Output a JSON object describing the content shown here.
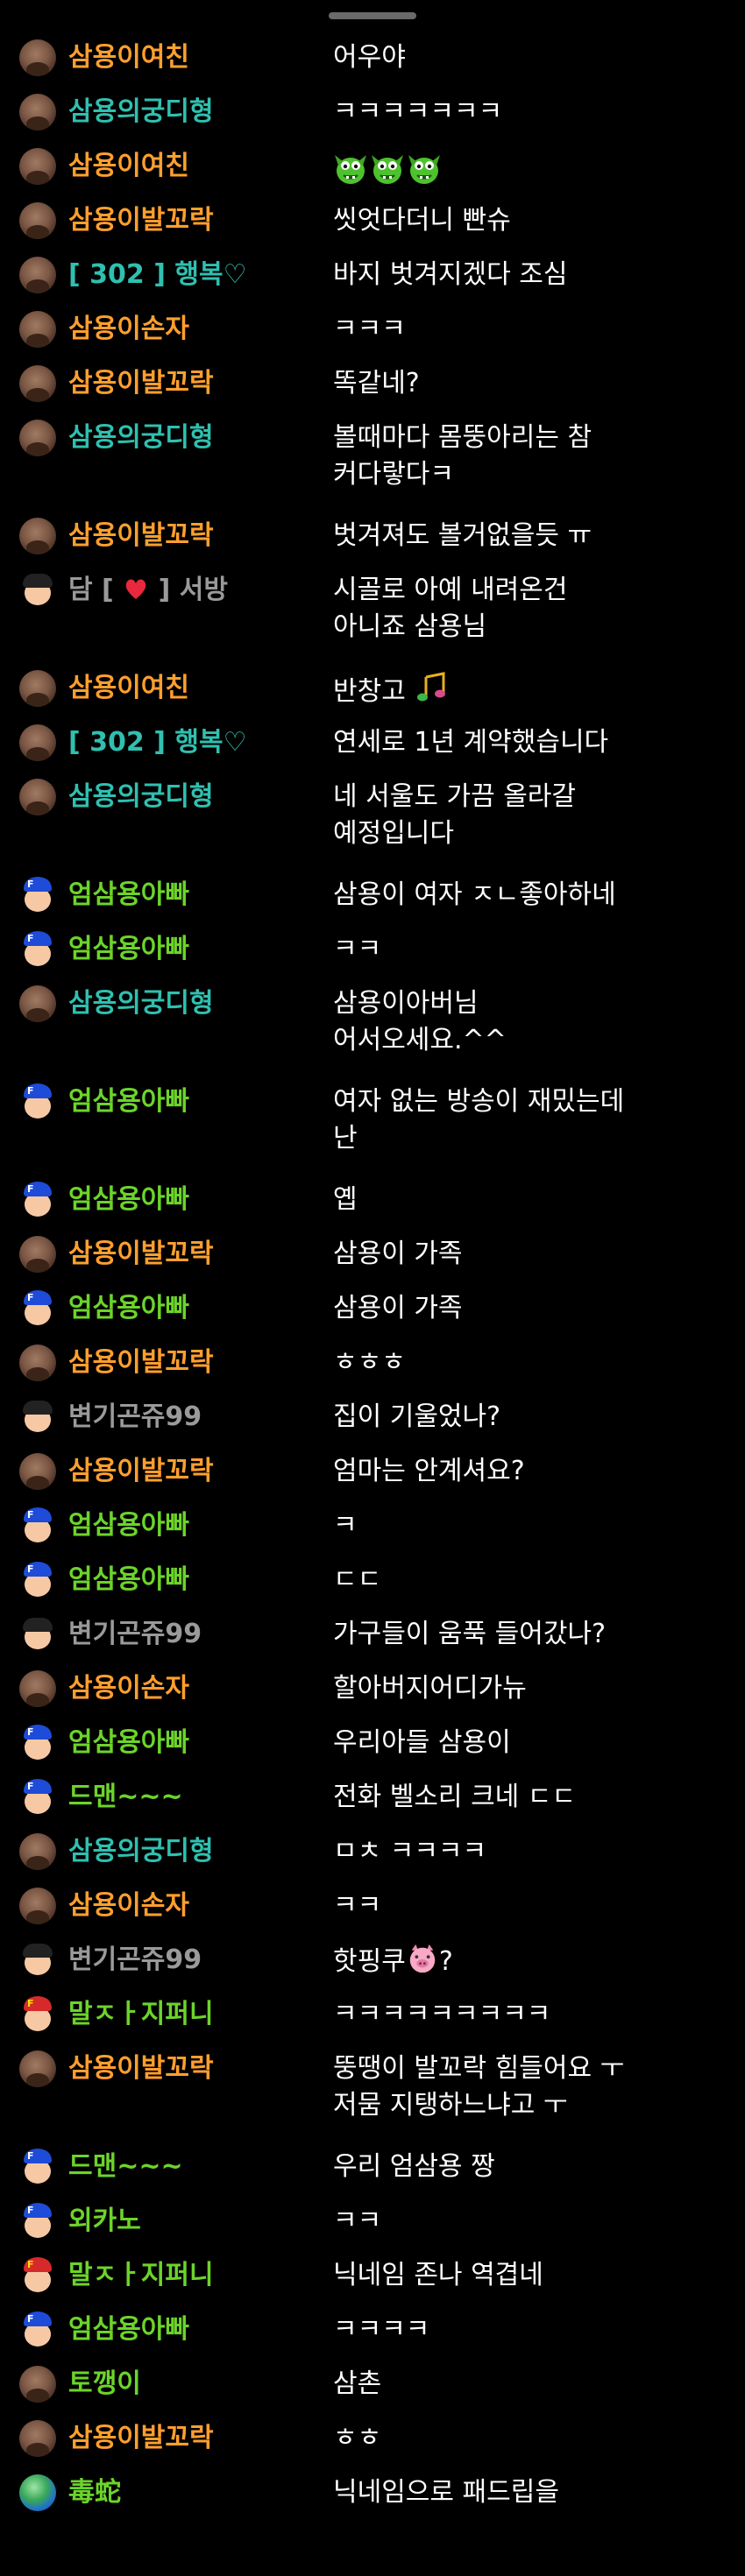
{
  "colors": {
    "background": "#000000",
    "message": "#ffffff",
    "orange": "#ff9f2e",
    "teal": "#2fc0b0",
    "green": "#6cd42a",
    "gray": "#9a9a9a",
    "purple_red": "#cc3d5a"
  },
  "chat": [
    {
      "user": "삼용이여친",
      "color": "#ff9f2e",
      "avatar": "round-brown",
      "text": "어우야"
    },
    {
      "user": "삼용의궁디형",
      "color": "#2fc0b0",
      "avatar": "round-brown",
      "text": "ㅋㅋㅋㅋㅋㅋㅋ"
    },
    {
      "user": "삼용이여친",
      "color": "#ff9f2e",
      "avatar": "round-brown",
      "text": "",
      "emote": "green-monster-emote",
      "emote_count": 3
    },
    {
      "user": "삼용이발꼬락",
      "color": "#ff9f2e",
      "avatar": "round-brown",
      "text": "씻엇다더니 빤슈"
    },
    {
      "user": "[ 302 ] 행복♡",
      "color": "#2fc0b0",
      "avatar": "round-brown",
      "text": "바지 벗겨지겠다 조심"
    },
    {
      "user": "삼용이손자",
      "color": "#ff9f2e",
      "avatar": "round-brown",
      "text": "ㅋㅋㅋ"
    },
    {
      "user": "삼용이발꼬락",
      "color": "#ff9f2e",
      "avatar": "round-brown",
      "text": "똑같네?"
    },
    {
      "user": "삼용의궁디형",
      "color": "#2fc0b0",
      "avatar": "round-brown",
      "text": "볼때마다 몸뚱아리는 참\n커다랗다ㅋ"
    },
    {
      "user": "삼용이발꼬락",
      "color": "#ff9f2e",
      "avatar": "round-brown",
      "text": "벗겨져도 볼거없을듯 ㅠ"
    },
    {
      "user_prefix": "담 [",
      "user_suffix": "] 서방",
      "heart": true,
      "color": "#9a9a9a",
      "avatar": "face-kid",
      "text": "시골로 아예 내려온건\n아니죠 삼용님"
    },
    {
      "user": "삼용이여친",
      "color": "#ff9f2e",
      "avatar": "round-brown",
      "text": "반창고",
      "icon": "music-note-icon"
    },
    {
      "user": "[ 302 ] 행복♡",
      "color": "#2fc0b0",
      "avatar": "round-brown",
      "text": "연세로 1년 계약했습니다"
    },
    {
      "user": "삼용의궁디형",
      "color": "#2fc0b0",
      "avatar": "round-brown",
      "text": "네 서울도 가끔 올라갈\n예정입니다"
    },
    {
      "user": "엄삼용아빠",
      "color": "#6cd42a",
      "avatar": "face-cap-blue",
      "text": "삼용이 여자 ㅈㄴ좋아하네"
    },
    {
      "user": "엄삼용아빠",
      "color": "#6cd42a",
      "avatar": "face-cap-blue",
      "text": "ㅋㅋ"
    },
    {
      "user": "삼용의궁디형",
      "color": "#2fc0b0",
      "avatar": "round-brown",
      "text": "삼용이아버님\n어서오세요.^^"
    },
    {
      "user": "엄삼용아빠",
      "color": "#6cd42a",
      "avatar": "face-cap-blue",
      "text": "여자 없는 방송이 재밌는데\n난"
    },
    {
      "user": "엄삼용아빠",
      "color": "#6cd42a",
      "avatar": "face-cap-blue",
      "text": "옙"
    },
    {
      "user": "삼용이발꼬락",
      "color": "#ff9f2e",
      "avatar": "round-brown",
      "text": "삼용이 가족"
    },
    {
      "user": "엄삼용아빠",
      "color": "#6cd42a",
      "avatar": "face-cap-blue",
      "text": "삼용이 가족"
    },
    {
      "user": "삼용이발꼬락",
      "color": "#ff9f2e",
      "avatar": "round-brown",
      "text": "ㅎㅎㅎ"
    },
    {
      "user": "변기곤쥬99",
      "color": "#9a9a9a",
      "avatar": "face-kid",
      "text": "집이 기울었나?"
    },
    {
      "user": "삼용이발꼬락",
      "color": "#ff9f2e",
      "avatar": "round-brown",
      "text": "엄마는 안계셔요?"
    },
    {
      "user": "엄삼용아빠",
      "color": "#6cd42a",
      "avatar": "face-cap-blue",
      "text": "ㅋ"
    },
    {
      "user": "엄삼용아빠",
      "color": "#6cd42a",
      "avatar": "face-cap-blue",
      "text": "ㄷㄷ"
    },
    {
      "user": "변기곤쥬99",
      "color": "#9a9a9a",
      "avatar": "face-kid",
      "text": "가구들이 움푹 들어갔나?"
    },
    {
      "user": "삼용이손자",
      "color": "#ff9f2e",
      "avatar": "round-brown",
      "text": "할아버지어디가뉴"
    },
    {
      "user": "엄삼용아빠",
      "color": "#6cd42a",
      "avatar": "face-cap-blue",
      "text": "우리아들 삼용이"
    },
    {
      "user": "드맨~~~",
      "color": "#6cd42a",
      "avatar": "face-cap-blue",
      "text": "전화 벨소리 크네 ㄷㄷ"
    },
    {
      "user": "삼용의궁디형",
      "color": "#2fc0b0",
      "avatar": "round-brown",
      "text": "ㅁㅊ ㅋㅋㅋㅋ"
    },
    {
      "user": "삼용이손자",
      "color": "#ff9f2e",
      "avatar": "round-brown",
      "text": "ㅋㅋ"
    },
    {
      "user": "변기곤쥬99",
      "color": "#9a9a9a",
      "avatar": "face-kid",
      "text": "핫핑쿠",
      "text_after": "?",
      "icon": "pig-icon"
    },
    {
      "user": "말ㅈㅏ지퍼니",
      "color": "#6cd42a",
      "avatar": "face-cap-red",
      "text": "ㅋㅋㅋㅋㅋㅋㅋㅋㅋ"
    },
    {
      "user": "삼용이발꼬락",
      "color": "#ff9f2e",
      "avatar": "round-brown",
      "text": "뚱땡이 발꼬락 힘들어요 ㅜ\n저뭄 지탱하느냐고 ㅜ"
    },
    {
      "user": "드맨~~~",
      "color": "#6cd42a",
      "avatar": "face-cap-blue",
      "text": "우리 엄삼용 짱"
    },
    {
      "user": "외카노",
      "color": "#6cd42a",
      "avatar": "face-cap-blue",
      "text": "ㅋㅋ"
    },
    {
      "user": "말ㅈㅏ지퍼니",
      "color": "#6cd42a",
      "avatar": "face-cap-red",
      "text": "닉네임 존나 역겹네"
    },
    {
      "user": "엄삼용아빠",
      "color": "#6cd42a",
      "avatar": "face-cap-blue",
      "text": "ㅋㅋㅋㅋ"
    },
    {
      "user": "토깽이",
      "color": "#6cd42a",
      "avatar": "round-brown",
      "text": "삼촌"
    },
    {
      "user": "삼용이발꼬락",
      "color": "#ff9f2e",
      "avatar": "round-brown",
      "text": "ㅎㅎ"
    },
    {
      "user": "毒蛇",
      "color": "#6cd42a",
      "avatar": "globe",
      "text": "닉네임으로 패드립을"
    }
  ]
}
